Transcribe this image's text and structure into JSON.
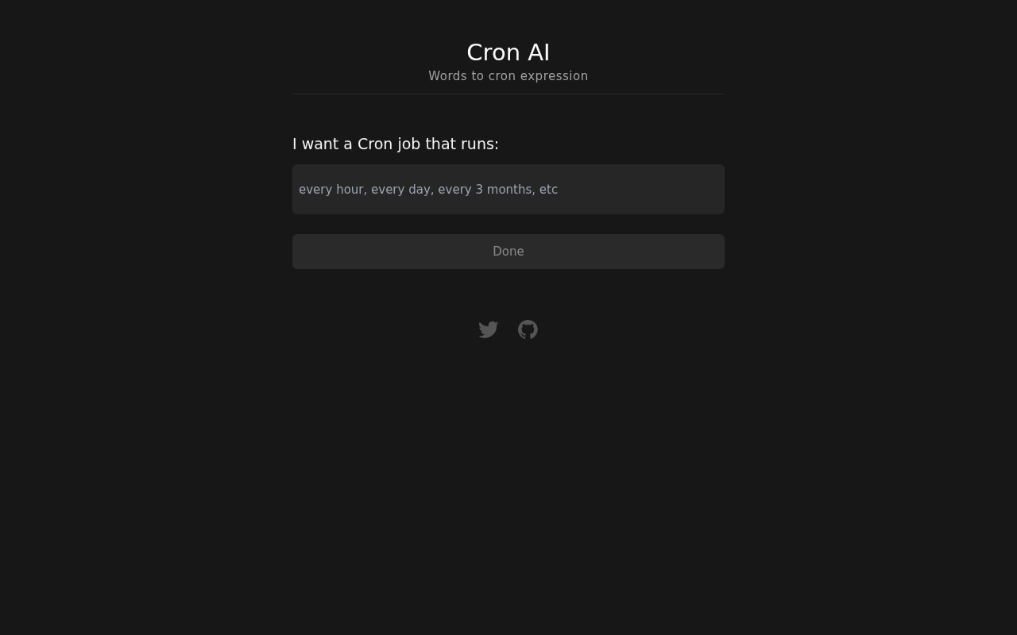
{
  "header": {
    "title": "Cron AI",
    "subtitle": "Words to cron expression"
  },
  "form": {
    "label": "I want a Cron job that runs:",
    "input": {
      "placeholder": "every hour, every day, every 3 months, etc"
    },
    "button": {
      "label": "Done",
      "disabled": true
    }
  },
  "footer": {
    "links": [
      {
        "kind": "bird"
      },
      {
        "kind": "cat"
      }
    ]
  }
}
